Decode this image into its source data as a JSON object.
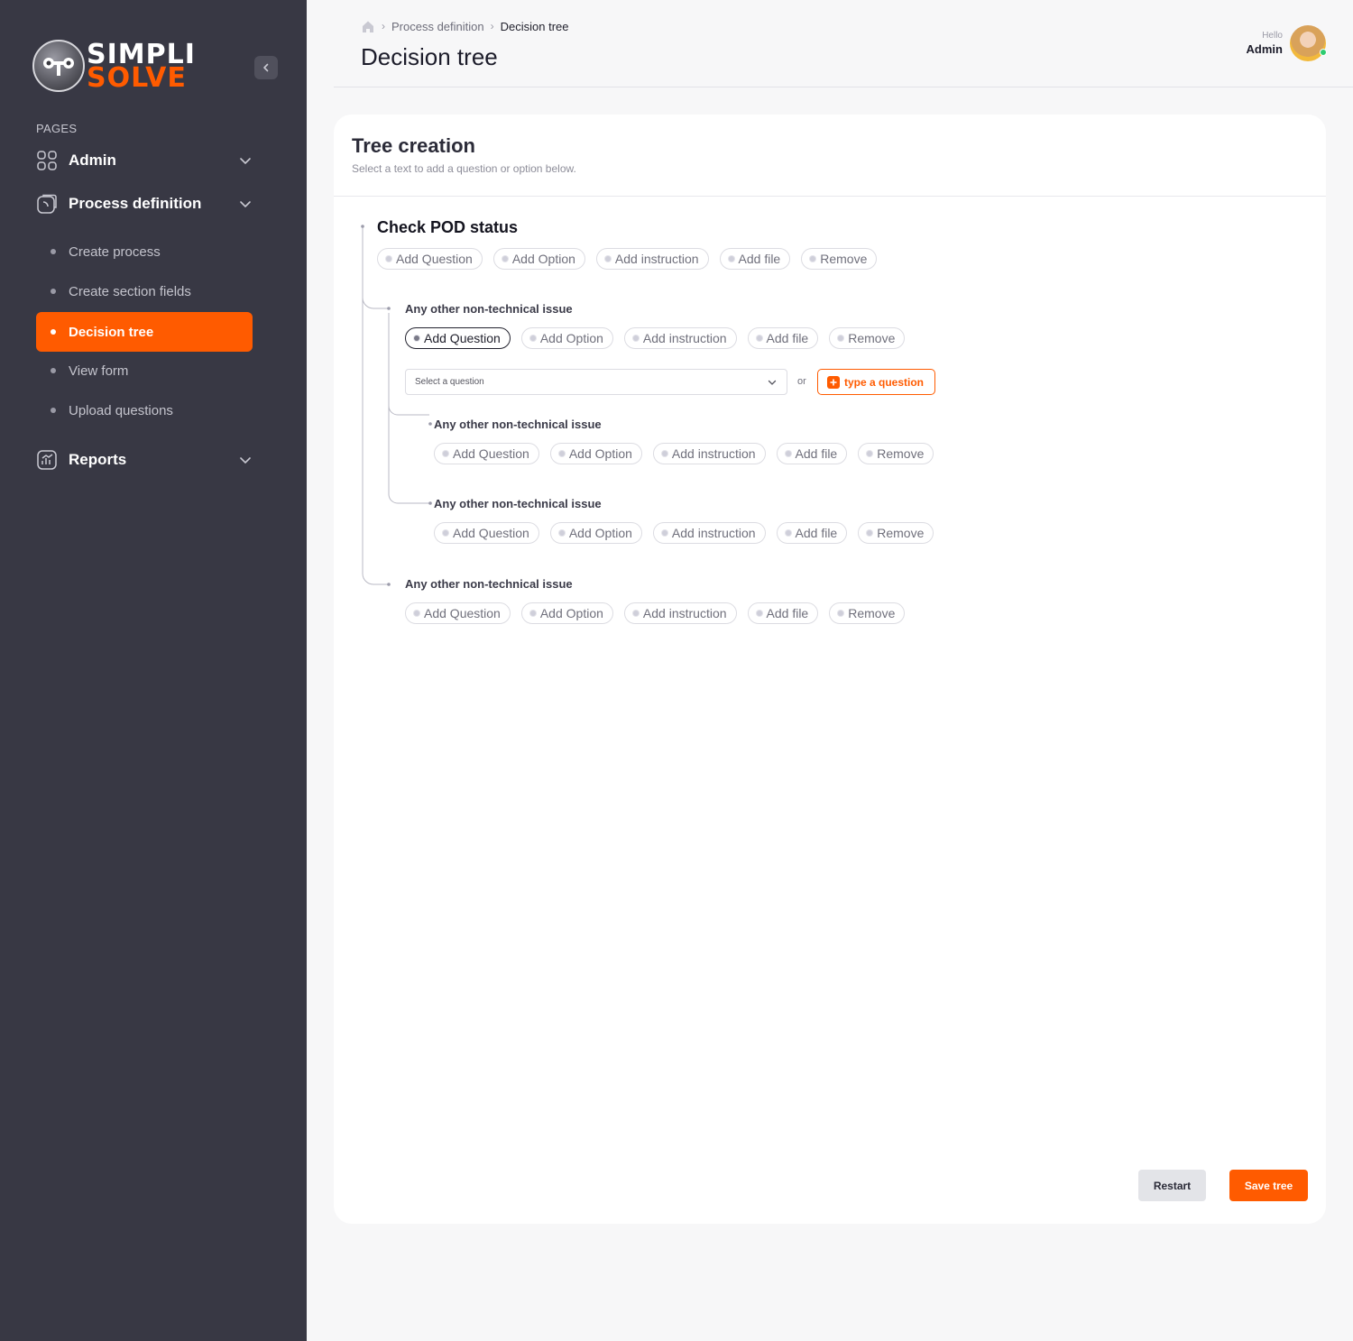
{
  "brand": {
    "name_top": "SIMPLI",
    "name_bottom": "SOLVE",
    "accent": "#ff5b00",
    "sidebar_bg": "#383844"
  },
  "sidebar": {
    "section_label": "PAGES",
    "groups": [
      {
        "label": "Admin",
        "icon": "grid-icon"
      },
      {
        "label": "Process definition",
        "icon": "process-icon"
      },
      {
        "label": "Reports",
        "icon": "chart-icon"
      }
    ],
    "process_items": [
      {
        "label": "Create process"
      },
      {
        "label": "Create section fields"
      },
      {
        "label": "Decision tree",
        "active": true
      },
      {
        "label": "View form"
      },
      {
        "label": "Upload questions"
      }
    ]
  },
  "breadcrumb": {
    "items": [
      "Process definition",
      "Decision tree"
    ]
  },
  "header": {
    "title": "Decision tree"
  },
  "user": {
    "greeting": "Hello",
    "name": "Admin"
  },
  "card": {
    "title": "Tree creation",
    "subtitle": "Select a text to add a question or option below."
  },
  "chip_labels": [
    "Add Question",
    "Add Option",
    "Add instruction",
    "Add file",
    "Remove"
  ],
  "tree": {
    "root": {
      "title": "Check POD status"
    },
    "nodes": [
      {
        "title": "Any other non-technical issue"
      },
      {
        "title": "Any other non-technical issue"
      },
      {
        "title": "Any other non-technical issue"
      },
      {
        "title": "Any other non-technical issue"
      }
    ]
  },
  "question_picker": {
    "select_value": "Select a question",
    "or_label": "or",
    "type_label": "type a question"
  },
  "footer": {
    "restart_label": "Restart",
    "save_label": "Save tree"
  }
}
